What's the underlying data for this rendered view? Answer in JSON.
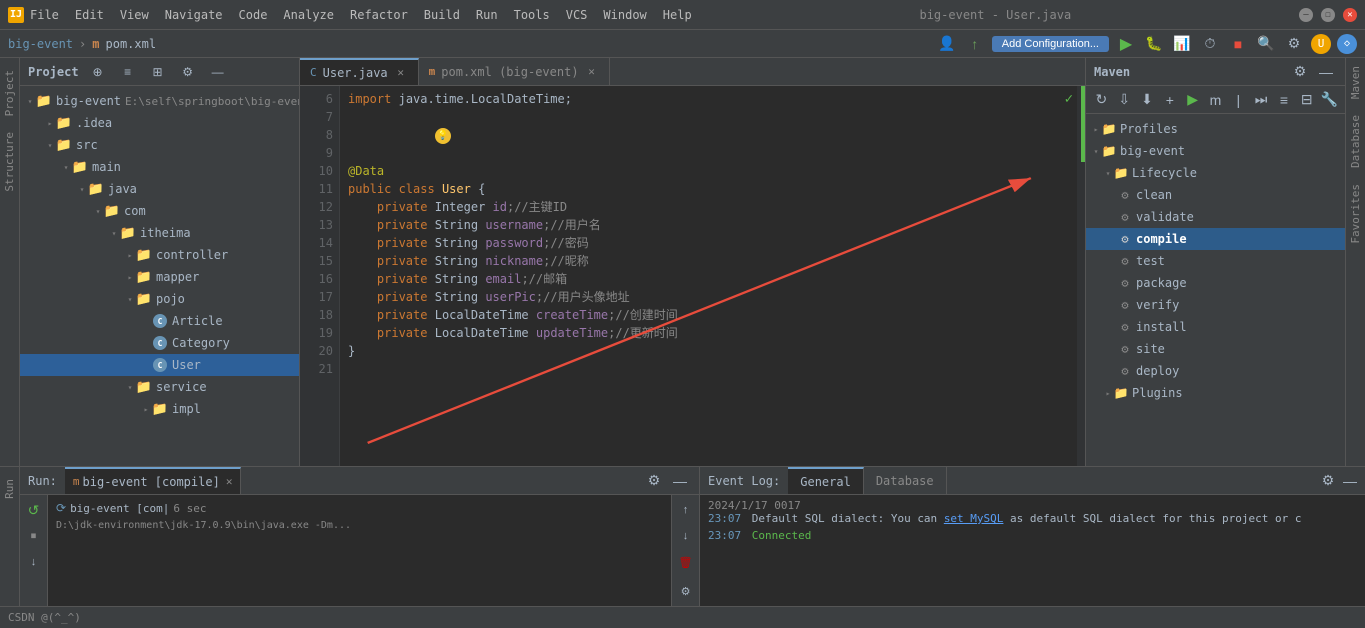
{
  "titlebar": {
    "app_icon": "IJ",
    "menus": [
      "File",
      "Edit",
      "View",
      "Navigate",
      "Code",
      "Analyze",
      "Refactor",
      "Build",
      "Run",
      "Tools",
      "VCS",
      "Window",
      "Help"
    ],
    "file_title": "big-event - User.java",
    "minimize": "—",
    "maximize": "☐",
    "close": "✕"
  },
  "breadcrumb": {
    "project": "big-event",
    "sep1": "›",
    "file": "pom.xml"
  },
  "toolbar": {
    "add_config": "Add Configuration...",
    "search_icon": "🔍",
    "avatar_icon": "👤",
    "run_icon": "▶",
    "stop_icon": "■"
  },
  "sidebar": {
    "header": "Project",
    "items": [
      {
        "label": "big-event",
        "path": "E:\\self\\springboot\\big-event",
        "depth": 0,
        "type": "root",
        "expanded": true
      },
      {
        "label": ".idea",
        "depth": 1,
        "type": "folder",
        "expanded": false
      },
      {
        "label": "src",
        "depth": 1,
        "type": "folder",
        "expanded": true
      },
      {
        "label": "main",
        "depth": 2,
        "type": "folder",
        "expanded": true
      },
      {
        "label": "java",
        "depth": 3,
        "type": "folder",
        "expanded": true
      },
      {
        "label": "com",
        "depth": 4,
        "type": "folder",
        "expanded": true
      },
      {
        "label": "itheima",
        "depth": 5,
        "type": "folder",
        "expanded": true
      },
      {
        "label": "controller",
        "depth": 6,
        "type": "folder",
        "expanded": false
      },
      {
        "label": "mapper",
        "depth": 6,
        "type": "folder",
        "expanded": false
      },
      {
        "label": "pojo",
        "depth": 6,
        "type": "folder",
        "expanded": true
      },
      {
        "label": "Article",
        "depth": 7,
        "type": "java-blue"
      },
      {
        "label": "Category",
        "depth": 7,
        "type": "java-blue"
      },
      {
        "label": "User",
        "depth": 7,
        "type": "java-blue"
      },
      {
        "label": "service",
        "depth": 6,
        "type": "folder",
        "expanded": false
      },
      {
        "label": "impl",
        "depth": 7,
        "type": "folder",
        "expanded": false
      }
    ]
  },
  "tabs": [
    {
      "label": "User.java",
      "type": "java",
      "active": true
    },
    {
      "label": "pom.xml (big-event)",
      "type": "maven",
      "active": false
    }
  ],
  "code": {
    "lines": [
      {
        "num": 6,
        "content": ""
      },
      {
        "num": 7,
        "content": "import java.time.LocalDateTime;"
      },
      {
        "num": 8,
        "content": ""
      },
      {
        "num": 9,
        "content": "@Data"
      },
      {
        "num": 10,
        "content": "public class User {"
      },
      {
        "num": 11,
        "content": "    private Integer id;//主键ID"
      },
      {
        "num": 12,
        "content": "    private String username;//用户名"
      },
      {
        "num": 13,
        "content": "    private String password;//密码"
      },
      {
        "num": 14,
        "content": "    private String nickname;//昵称"
      },
      {
        "num": 15,
        "content": "    private String email;//邮箱"
      },
      {
        "num": 16,
        "content": "    private String userPic;//用户头像地址"
      },
      {
        "num": 17,
        "content": "    private LocalDateTime createTime;//创建时间"
      },
      {
        "num": 18,
        "content": "    private LocalDateTime updateTime;//更新时间"
      },
      {
        "num": 19,
        "content": "}"
      },
      {
        "num": 20,
        "content": ""
      },
      {
        "num": 21,
        "content": ""
      }
    ]
  },
  "maven": {
    "title": "Maven",
    "profiles_label": "Profiles",
    "project_label": "big-event",
    "lifecycle_label": "Lifecycle",
    "lifecycle_items": [
      {
        "label": "clean"
      },
      {
        "label": "validate"
      },
      {
        "label": "compile",
        "selected": true
      },
      {
        "label": "test"
      },
      {
        "label": "package"
      },
      {
        "label": "verify"
      },
      {
        "label": "install"
      },
      {
        "label": "site"
      },
      {
        "label": "deploy"
      }
    ],
    "plugins_label": "Plugins"
  },
  "run_panel": {
    "label": "Run:",
    "tab_label": "big-event [compile]",
    "process_label": "big-event [com|",
    "process_seconds": "6 sec",
    "command_text": "D:\\jdk-environment\\jdk-17.0.9\\bin\\java.exe -Dm..."
  },
  "event_log": {
    "title": "Event Log:",
    "tabs": [
      "General",
      "Database"
    ],
    "entries": [
      {
        "date": "2024/1/17",
        "num": "0017",
        "time": "23:07",
        "text": "Default SQL dialect: You can ",
        "link": "set MySQL",
        "text2": " as default SQL dialect for this project or c"
      },
      {
        "date": "",
        "num": "",
        "time": "23:07",
        "text": "Connected",
        "link": "",
        "text2": ""
      }
    ]
  },
  "status_bar": {
    "items": [
      "CSDN @(^_^)"
    ]
  }
}
